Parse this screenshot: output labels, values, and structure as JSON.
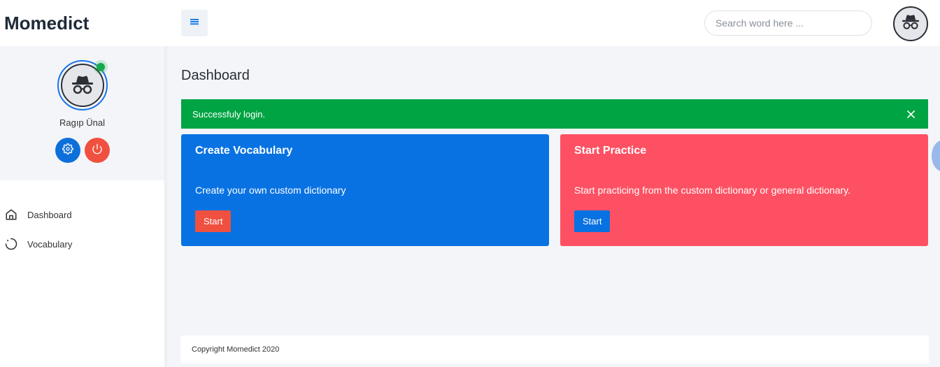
{
  "app": {
    "brand": "Momedict"
  },
  "profile": {
    "name": "Ragıp Ünal",
    "status_color": "#17a84b"
  },
  "sidebar": {
    "items": [
      {
        "label": "Dashboard",
        "icon": "home-icon"
      },
      {
        "label": "Vocabulary",
        "icon": "loader-icon"
      }
    ]
  },
  "topbar": {
    "search_placeholder": "Search word here ..."
  },
  "page": {
    "title": "Dashboard"
  },
  "alert": {
    "message": "Successfuly login.",
    "color": "#00a443"
  },
  "cards": [
    {
      "title": "Create Vocabulary",
      "text": "Create your own custom dictionary",
      "button": "Start",
      "color": "#0872e2"
    },
    {
      "title": "Start Practice",
      "text": "Start practicing from the custom dictionary or general dictionary.",
      "button": "Start",
      "color": "#fd5163"
    }
  ],
  "footer": {
    "text": "Copyright Momedict 2020"
  }
}
